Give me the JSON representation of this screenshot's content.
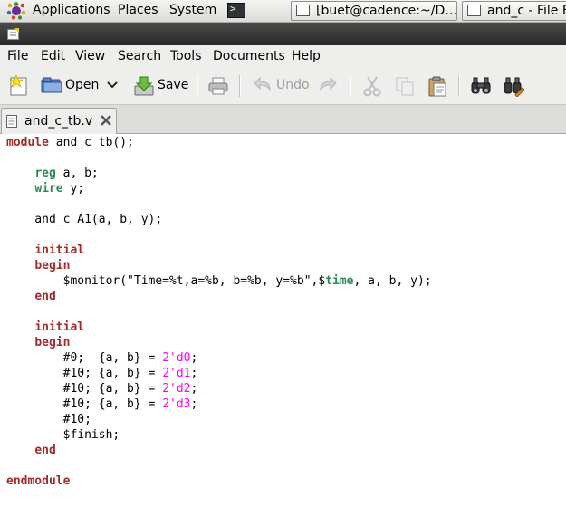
{
  "panel": {
    "applications_label": "Applications",
    "places_label": "Places",
    "system_label": "System",
    "terminal_icon_glyph": ">_",
    "tasks": [
      {
        "label": "[buet@cadence:~/D…",
        "icon": "terminal-window-icon"
      },
      {
        "label": "and_c - File B",
        "icon": "file-window-icon"
      }
    ]
  },
  "menubar": {
    "items": [
      "File",
      "Edit",
      "View",
      "Search",
      "Tools",
      "Documents",
      "Help"
    ]
  },
  "toolbar": {
    "open_label": "Open",
    "save_label": "Save",
    "undo_label": "Undo",
    "icons": [
      "new-document-icon",
      "open-folder-icon",
      "dropdown-arrow-icon",
      "save-icon",
      "print-icon",
      "undo-icon",
      "redo-icon",
      "cut-icon",
      "copy-icon",
      "paste-icon",
      "find-icon",
      "find-replace-icon"
    ],
    "colors": {
      "disabled": "#a0a0a0",
      "new_star": "#f5e11e"
    }
  },
  "tabs": [
    {
      "label": "and_c_tb.v",
      "active": true
    }
  ],
  "editor": {
    "colors": {
      "keyword": "#a52a2a",
      "type": "#2e8b57",
      "number": "#ff00ff",
      "system_task": "#2e8b57"
    },
    "lines": [
      [
        {
          "t": "module",
          "c": "kw"
        },
        {
          "t": " and_c_tb();"
        }
      ],
      [],
      [
        {
          "t": "    "
        },
        {
          "t": "reg",
          "c": "ty"
        },
        {
          "t": " a, b;"
        }
      ],
      [
        {
          "t": "    "
        },
        {
          "t": "wire",
          "c": "ty"
        },
        {
          "t": " y;"
        }
      ],
      [],
      [
        {
          "t": "    and_c A1(a, b, y);"
        }
      ],
      [],
      [
        {
          "t": "    "
        },
        {
          "t": "initial",
          "c": "kw"
        }
      ],
      [
        {
          "t": "    "
        },
        {
          "t": "begin",
          "c": "kw"
        }
      ],
      [
        {
          "t": "        $monitor(\"Time=%t,a=%b, b=%b, y=%b\",$"
        },
        {
          "t": "time",
          "c": "sys"
        },
        {
          "t": ", a, b, y);"
        }
      ],
      [
        {
          "t": "    "
        },
        {
          "t": "end",
          "c": "kw"
        }
      ],
      [],
      [
        {
          "t": "    "
        },
        {
          "t": "initial",
          "c": "kw"
        }
      ],
      [
        {
          "t": "    "
        },
        {
          "t": "begin",
          "c": "kw"
        }
      ],
      [
        {
          "t": "        #0;  {a, b} = "
        },
        {
          "t": "2'd0",
          "c": "num"
        },
        {
          "t": ";"
        }
      ],
      [
        {
          "t": "        #10; {a, b} = "
        },
        {
          "t": "2'd1",
          "c": "num"
        },
        {
          "t": ";"
        }
      ],
      [
        {
          "t": "        #10; {a, b} = "
        },
        {
          "t": "2'd2",
          "c": "num"
        },
        {
          "t": ";"
        }
      ],
      [
        {
          "t": "        #10; {a, b} = "
        },
        {
          "t": "2'd3",
          "c": "num"
        },
        {
          "t": ";"
        }
      ],
      [
        {
          "t": "        #10;"
        }
      ],
      [
        {
          "t": "        $finish;"
        }
      ],
      [
        {
          "t": "    "
        },
        {
          "t": "end",
          "c": "kw"
        }
      ],
      [],
      [
        {
          "t": "endmodule",
          "c": "kw"
        }
      ]
    ]
  }
}
